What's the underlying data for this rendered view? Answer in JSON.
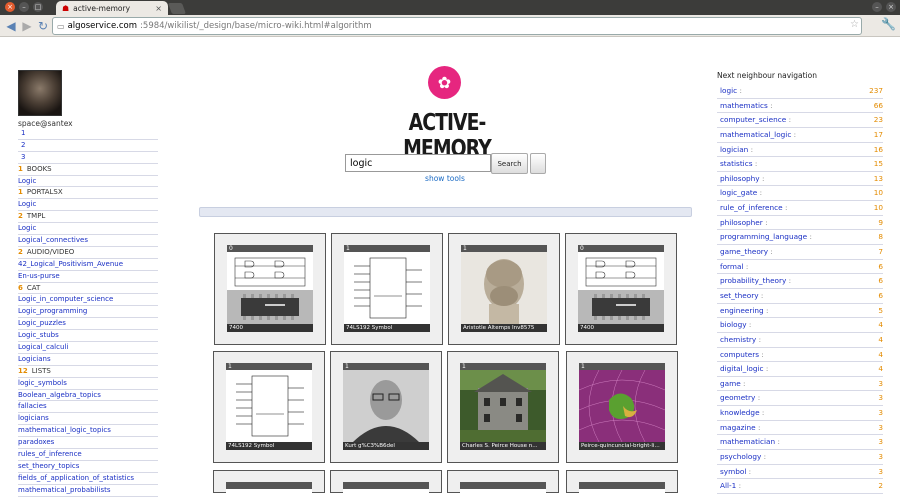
{
  "browser": {
    "tab_title": "active-memory",
    "url_host": "algoservice.com",
    "url_path": ":5984/wikilist/_design/base/micro-wiki.html#algorithm"
  },
  "colors": {
    "accent_pink": "#e6267f",
    "link_blue": "#1a2fc4",
    "count_orange": "#e38b00"
  },
  "user": {
    "name": "space@santex"
  },
  "left_list": [
    {
      "type": "num",
      "text": "1"
    },
    {
      "type": "num",
      "text": "2"
    },
    {
      "type": "num",
      "text": "3"
    },
    {
      "type": "cat",
      "count": "1",
      "text": "BOOKS"
    },
    {
      "type": "link",
      "text": "Logic"
    },
    {
      "type": "cat",
      "count": "1",
      "text": "PORTALSX"
    },
    {
      "type": "link",
      "text": "Logic"
    },
    {
      "type": "cat",
      "count": "2",
      "text": "TMPL"
    },
    {
      "type": "link",
      "text": "Logic"
    },
    {
      "type": "link",
      "text": "Logical_connectives"
    },
    {
      "type": "cat",
      "count": "2",
      "text": "AUDIO/VIDEO"
    },
    {
      "type": "link",
      "text": "42_Logical_Positivism_Avenue"
    },
    {
      "type": "link",
      "text": "En-us-purse"
    },
    {
      "type": "cat",
      "count": "6",
      "text": "CAT"
    },
    {
      "type": "link",
      "text": "Logic_in_computer_science"
    },
    {
      "type": "link",
      "text": "Logic_programming"
    },
    {
      "type": "link",
      "text": "Logic_puzzles"
    },
    {
      "type": "link",
      "text": "Logic_stubs"
    },
    {
      "type": "link",
      "text": "Logical_calculi"
    },
    {
      "type": "link",
      "text": "Logicians"
    },
    {
      "type": "cat",
      "count": "12",
      "text": "LISTS"
    },
    {
      "type": "link",
      "text": "logic_symbols"
    },
    {
      "type": "link",
      "text": "Boolean_algebra_topics"
    },
    {
      "type": "link",
      "text": "fallacies"
    },
    {
      "type": "link",
      "text": "logicians"
    },
    {
      "type": "link",
      "text": "mathematical_logic_topics"
    },
    {
      "type": "link",
      "text": "paradoxes"
    },
    {
      "type": "link",
      "text": "rules_of_inference"
    },
    {
      "type": "link",
      "text": "set_theory_topics"
    },
    {
      "type": "link",
      "text": "fields_of_application_of_statistics"
    },
    {
      "type": "link",
      "text": "mathematical_probabilists"
    }
  ],
  "logo": {
    "text": "ACTIVE-MEMORY",
    "icon": "lotus-icon"
  },
  "search": {
    "value": "logic",
    "button_label": "Search",
    "show_tools": "show tools"
  },
  "thumbnails": [
    {
      "num": "0",
      "caption": "7400",
      "art": "ic-chip"
    },
    {
      "num": "1",
      "caption": "74LS192 Symbol",
      "art": "schematic"
    },
    {
      "num": "1",
      "caption": "Aristotle Altemps Inv8575",
      "art": "bust"
    },
    {
      "num": "0",
      "caption": "7400",
      "art": "ic-chip"
    },
    {
      "num": "1",
      "caption": "74LS192 Symbol",
      "art": "schematic"
    },
    {
      "num": "1",
      "caption": "Kurt g%C3%B6del",
      "art": "portrait"
    },
    {
      "num": "1",
      "caption": "Charles S. Peirce House n...",
      "art": "house"
    },
    {
      "num": "1",
      "caption": "Peirce-quincuncial-bright-li...",
      "art": "map"
    }
  ],
  "right_nav": {
    "title": "Next neighbour navigation",
    "items": [
      {
        "term": "logic",
        "count": "237"
      },
      {
        "term": "mathematics",
        "count": "66"
      },
      {
        "term": "computer_science",
        "count": "23"
      },
      {
        "term": "mathematical_logic",
        "count": "17"
      },
      {
        "term": "logician",
        "count": "16"
      },
      {
        "term": "statistics",
        "count": "15"
      },
      {
        "term": "philosophy",
        "count": "13"
      },
      {
        "term": "logic_gate",
        "count": "10"
      },
      {
        "term": "rule_of_inference",
        "count": "10"
      },
      {
        "term": "philosopher",
        "count": "9"
      },
      {
        "term": "programming_language",
        "count": "8"
      },
      {
        "term": "game_theory",
        "count": "7"
      },
      {
        "term": "formal",
        "count": "6"
      },
      {
        "term": "probability_theory",
        "count": "6"
      },
      {
        "term": "set_theory",
        "count": "6"
      },
      {
        "term": "engineering",
        "count": "5"
      },
      {
        "term": "biology",
        "count": "4"
      },
      {
        "term": "chemistry",
        "count": "4"
      },
      {
        "term": "computers",
        "count": "4"
      },
      {
        "term": "digital_logic",
        "count": "4"
      },
      {
        "term": "game",
        "count": "3"
      },
      {
        "term": "geometry",
        "count": "3"
      },
      {
        "term": "knowledge",
        "count": "3"
      },
      {
        "term": "magazine",
        "count": "3"
      },
      {
        "term": "mathematician",
        "count": "3"
      },
      {
        "term": "psychology",
        "count": "3"
      },
      {
        "term": "symbol",
        "count": "3"
      },
      {
        "term": "All-1",
        "count": "2"
      }
    ]
  }
}
